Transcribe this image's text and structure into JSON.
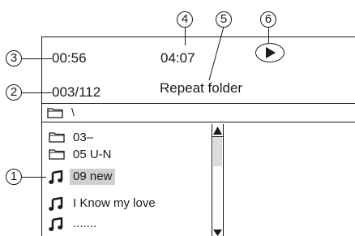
{
  "callouts": [
    "1",
    "2",
    "3",
    "4",
    "5",
    "6"
  ],
  "status": {
    "elapsed": "00:56",
    "total": "04:07",
    "track_counter": "003/112",
    "repeat_mode": "Repeat folder"
  },
  "path_bar": {
    "path": "\\"
  },
  "file_list": [
    {
      "type": "folder",
      "name": "03–",
      "selected": false
    },
    {
      "type": "folder",
      "name": "05 U-N",
      "selected": false
    },
    {
      "type": "music",
      "name": "09 new",
      "selected": true
    },
    {
      "type": "music",
      "name": "I Know my love",
      "selected": false
    },
    {
      "type": "music",
      "name": ".......",
      "selected": false
    }
  ],
  "icons": {
    "play": "play-icon",
    "folder": "folder-icon",
    "music": "music-note-icon",
    "scroll_up": "scroll-up-arrow-icon",
    "scroll_down": "scroll-down-arrow-icon"
  }
}
